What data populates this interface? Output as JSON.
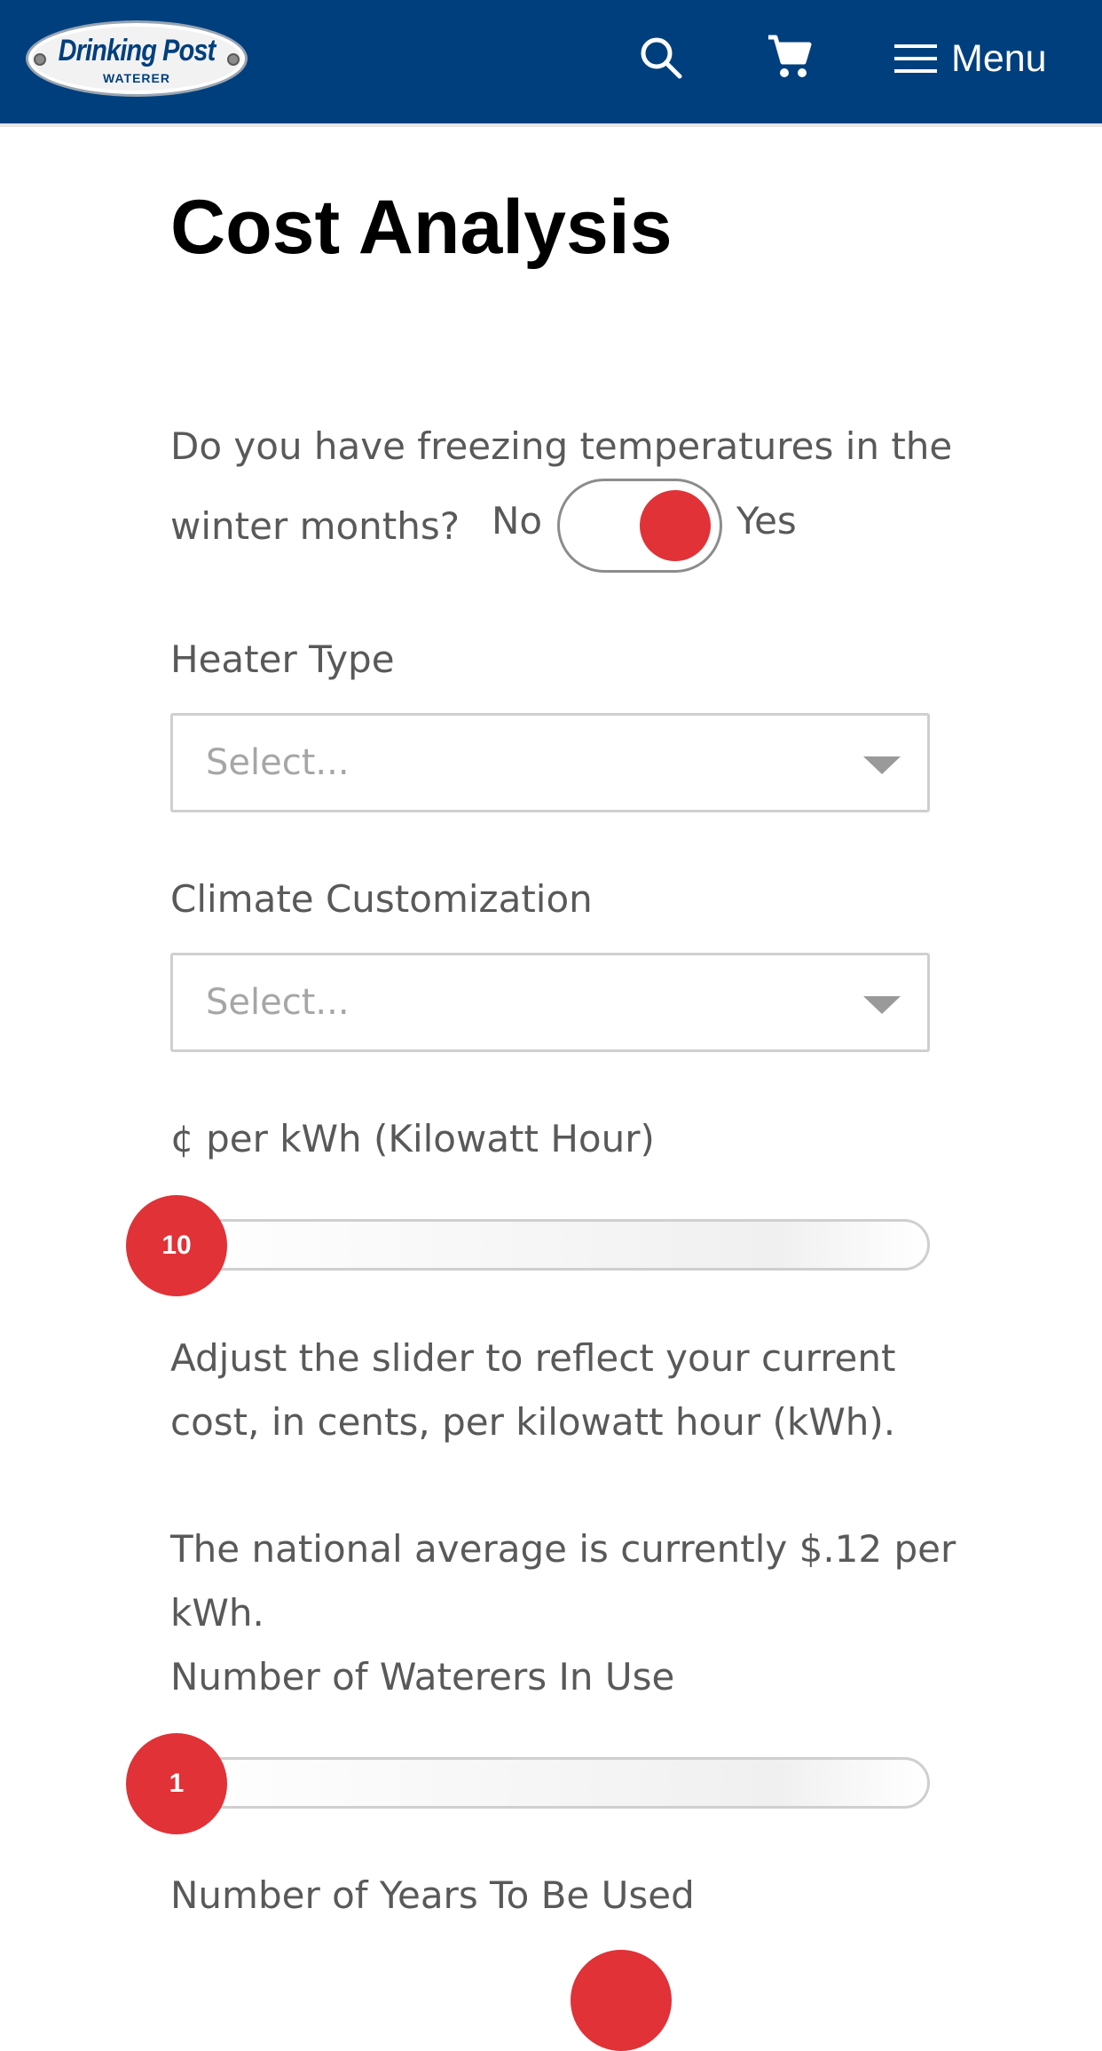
{
  "header": {
    "logo_main": "Drinking Post",
    "logo_sub": "WATERER",
    "menu_label": "Menu",
    "bg_color": "#003f7d",
    "icons": [
      "search-icon",
      "cart-icon",
      "hamburger-icon"
    ]
  },
  "page": {
    "title": "Cost Analysis"
  },
  "freezing": {
    "question_line1": "Do you have freezing temperatures in the",
    "question_line2": "winter months?",
    "no_label": "No",
    "yes_label": "Yes",
    "toggle_state": "Yes"
  },
  "heater": {
    "label": "Heater Type",
    "placeholder": "Select..."
  },
  "climate": {
    "label": "Climate Customization",
    "placeholder": "Select..."
  },
  "kwh": {
    "label": "¢ per kWh (Kilowatt Hour)",
    "value": "10",
    "help_line1": "Adjust the slider to reflect your current",
    "help_line2": "cost, in cents, per kilowatt hour (kWh).",
    "note_line1": "The national average is currently $.12 per",
    "note_line2": "kWh."
  },
  "waterers": {
    "label": "Number of Waterers In Use",
    "value": "1"
  },
  "years": {
    "label": "Number of Years To Be Used"
  },
  "accent_color": "#e03237"
}
